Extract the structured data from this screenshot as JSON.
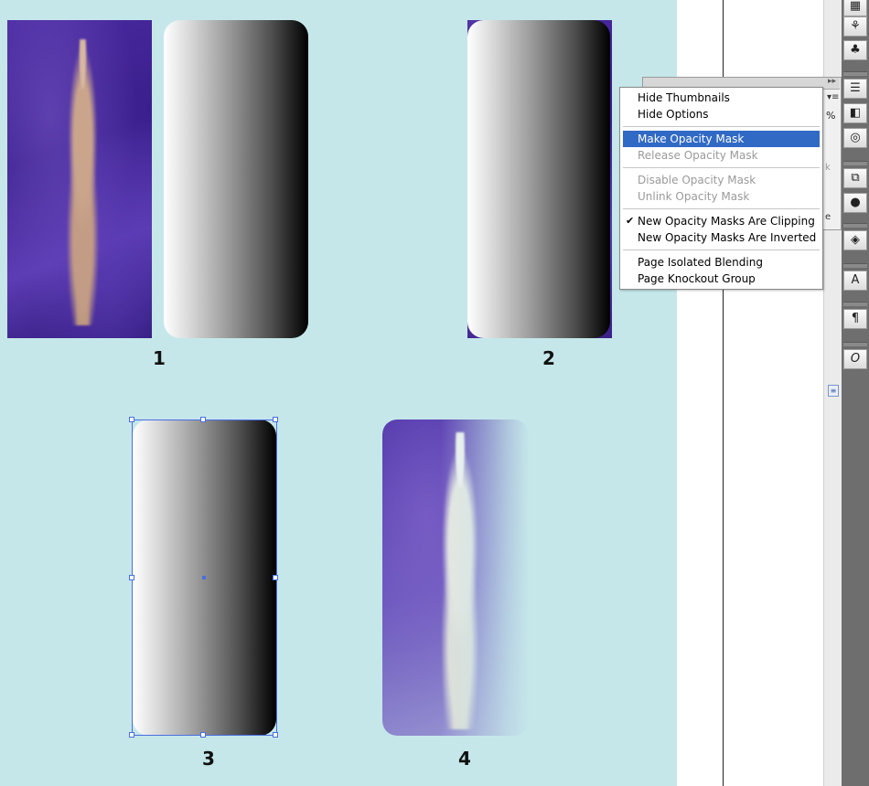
{
  "labels": {
    "one": "1",
    "two": "2",
    "three": "3",
    "four": "4"
  },
  "menu": {
    "items": [
      {
        "label": "Hide Thumbnails",
        "state": "normal"
      },
      {
        "label": "Hide Options",
        "state": "normal"
      },
      {
        "label": "Make Opacity Mask",
        "state": "highlighted"
      },
      {
        "label": "Release Opacity Mask",
        "state": "disabled"
      },
      {
        "label": "Disable Opacity Mask",
        "state": "disabled"
      },
      {
        "label": "Unlink Opacity Mask",
        "state": "disabled"
      },
      {
        "label": "New Opacity Masks Are Clipping",
        "state": "checked"
      },
      {
        "label": "New Opacity Masks Are Inverted",
        "state": "normal"
      },
      {
        "label": "Page Isolated Blending",
        "state": "normal"
      },
      {
        "label": "Page Knockout Group",
        "state": "normal"
      }
    ],
    "check_glyph": "✔"
  },
  "panel": {
    "percent_suffix": "%",
    "arrows": "▸▸",
    "menu_icon": "▾≡",
    "k": "k",
    "e": "e"
  },
  "tools": [
    {
      "name": "grid-icon",
      "glyph": "▦"
    },
    {
      "name": "symbol-sprayer-icon",
      "glyph": "⚘"
    },
    {
      "name": "club-symbol-icon",
      "glyph": "♣"
    },
    {
      "name": "stroke-icon",
      "glyph": "☰"
    },
    {
      "name": "gradient-icon",
      "glyph": "◧"
    },
    {
      "name": "transparency-icon",
      "glyph": "◎"
    },
    {
      "name": "transform-icon",
      "glyph": "⧉"
    },
    {
      "name": "appearance-icon",
      "glyph": "●"
    },
    {
      "name": "layers-icon",
      "glyph": "◈"
    },
    {
      "name": "character-icon",
      "glyph": "A"
    },
    {
      "name": "paragraph-icon",
      "glyph": "¶"
    },
    {
      "name": "opentype-icon",
      "glyph": "O"
    }
  ],
  "colors": {
    "canvas_bg": "#c5e7ea",
    "highlight": "#316ac5",
    "selection": "#4a6ee0"
  }
}
